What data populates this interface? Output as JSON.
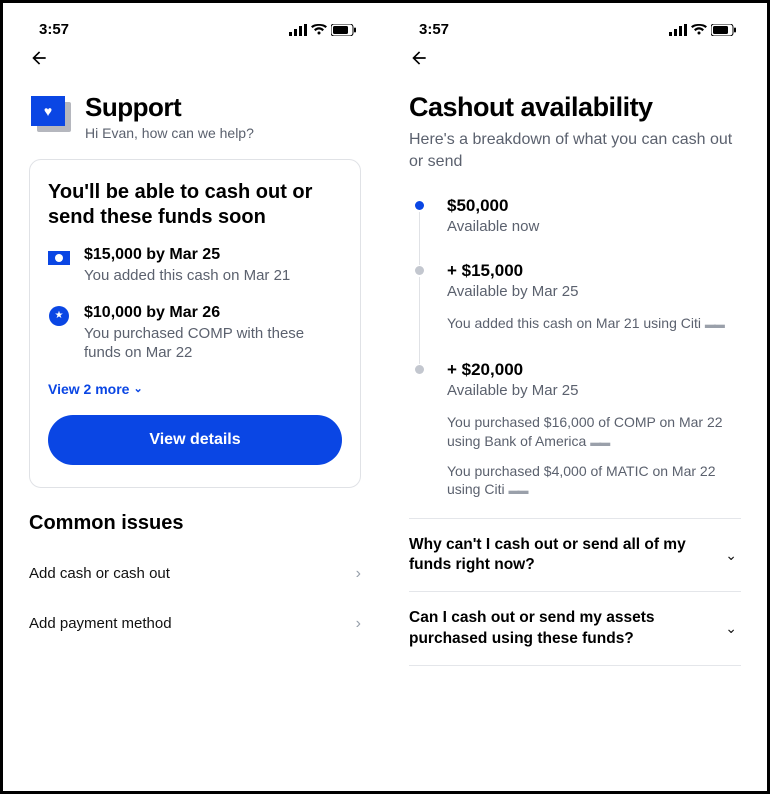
{
  "status": {
    "time": "3:57"
  },
  "screen1": {
    "header": {
      "title": "Support",
      "subtitle": "Hi Evan, how can we help?"
    },
    "card": {
      "title": "You'll be able to cash out or send these funds soon",
      "funds": [
        {
          "amount": "$15,000 by Mar 25",
          "desc": "You added this cash on Mar 21",
          "icon": "cash"
        },
        {
          "amount": "$10,000 by Mar 26",
          "desc": "You purchased COMP with these funds on Mar 22",
          "icon": "star"
        }
      ],
      "view_more": "View 2 more",
      "button": "View details"
    },
    "common": {
      "title": "Common issues",
      "items": [
        {
          "label": "Add cash or cash out"
        },
        {
          "label": "Add payment method"
        }
      ]
    }
  },
  "screen2": {
    "title": "Cashout availability",
    "subtitle": "Here's a breakdown of what you can cash out or send",
    "timeline": [
      {
        "amount": "$50,000",
        "sub": "Available now",
        "active": true,
        "notes": []
      },
      {
        "amount": "+ $15,000",
        "sub": "Available by Mar 25",
        "notes": [
          "You added this cash on Mar 21 using Citi"
        ]
      },
      {
        "amount": "+ $20,000",
        "sub": "Available by Mar 25",
        "notes": [
          "You purchased $16,000 of COMP on Mar 22  using Bank of America",
          "You purchased $4,000 of MATIC on Mar 22 using Citi"
        ]
      }
    ],
    "faqs": [
      {
        "q": "Why can't I cash out or send all of my funds right now?"
      },
      {
        "q": "Can I cash out or send my assets purchased using these funds?"
      }
    ]
  }
}
